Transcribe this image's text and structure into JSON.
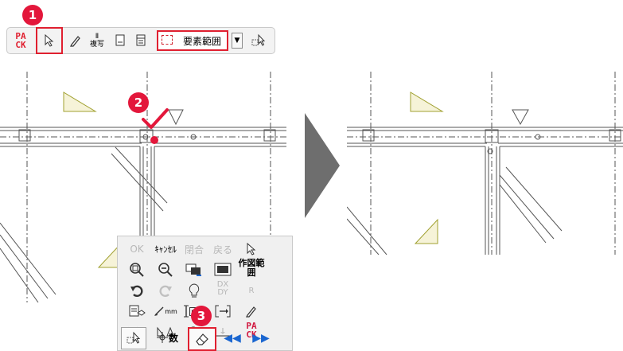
{
  "toolbar": {
    "pack_label_top": "PA",
    "pack_label_bottom": "CK",
    "copy_label_top": "Ⅱ",
    "copy_label": "複写",
    "range_label": "要素範囲",
    "dropdown_arrow": "▼"
  },
  "steps": {
    "s1": "1",
    "s2": "2",
    "s3": "3"
  },
  "palette": {
    "ok": "OK",
    "cancel": "ｷｬﾝｾﾙ",
    "close_loop": "閉合",
    "back": "戻る",
    "draw_range": "作図範囲",
    "dxdy_top": "DX",
    "dxdy_bottom": "DY",
    "r": "R",
    "mm_a": "mm",
    "mm_b": "mm",
    "pack_top": "PA",
    "pack_bottom": "CK",
    "numeric": "数",
    "prev": "◀◀",
    "next": "▶▶"
  },
  "colors": {
    "accent_red": "#e3173b",
    "highlight_box": "#e02030",
    "arrow_gray": "#6e6e6e",
    "plan_line": "#555555",
    "triangle_fill": "#f6f3d8",
    "triangle_stroke": "#a0a030"
  },
  "icons": [
    "pack-icon",
    "pointer-icon",
    "pen-icon",
    "copy-icon",
    "sheet-icon",
    "panel-icon",
    "range-icon",
    "element-select-icon",
    "check-icon",
    "zoom-in-icon",
    "zoom-out-icon",
    "move-view-icon",
    "window-icon",
    "undo-icon",
    "redo-icon",
    "bulb-icon",
    "layer-icon",
    "measure-icon",
    "dimension-icon",
    "insert-icon",
    "eyedropper-icon",
    "triangle-icon",
    "eraser-icon",
    "arrow-left-icon",
    "arrow-right-icon"
  ]
}
